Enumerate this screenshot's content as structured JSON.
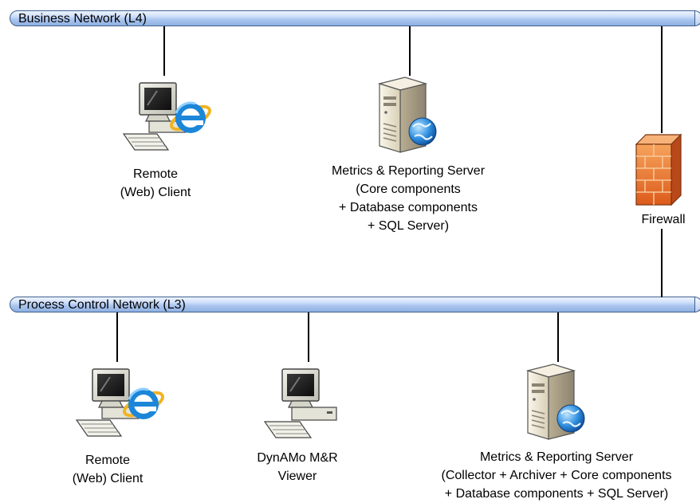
{
  "networks": {
    "business": {
      "label": "Business Network (L4)"
    },
    "process": {
      "label": "Process Control Network (L3)"
    }
  },
  "nodes": {
    "remote_client_l4": {
      "lines": [
        "Remote",
        "(Web) Client"
      ],
      "icon": "computer-with-ie-icon"
    },
    "mr_server_l4": {
      "lines": [
        "Metrics & Reporting Server",
        "(Core components",
        "+ Database components",
        "+ SQL Server)"
      ],
      "icon": "server-icon"
    },
    "firewall": {
      "lines": [
        "Firewall"
      ],
      "icon": "firewall-icon"
    },
    "remote_client_l3": {
      "lines": [
        "Remote",
        "(Web) Client"
      ],
      "icon": "computer-with-ie-icon"
    },
    "dynamo_viewer": {
      "lines": [
        "DynAMo M&R",
        "Viewer"
      ],
      "icon": "computer-icon"
    },
    "mr_server_l3": {
      "lines": [
        "Metrics & Reporting Server",
        "(Collector + Archiver + Core components",
        "+ Database components + SQL Server)"
      ],
      "icon": "server-icon"
    }
  },
  "colors": {
    "bus_fill": "#a9c4ee",
    "bus_border": "#3d5f8f",
    "firewall_orange": "#e8742c",
    "ie_blue": "#1c86d8",
    "server_beige": "#e9e2cf"
  }
}
